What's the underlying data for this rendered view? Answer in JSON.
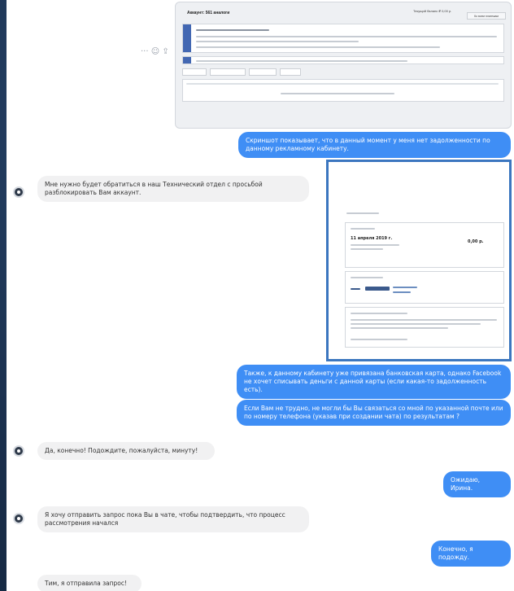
{
  "messages": {
    "m1": "Скриншот показывает, что в данный момент у меня нет задолженности по данному рекламному кабинету.",
    "m2": "Мне нужно будет обратиться в наш Технический отдел с просьбой разблокировать Вам аккаунт.",
    "m3": "Также, к данному кабинету уже привязана банковская карта, однако Facebook не хочет списывать деньги с данной карты (если какая-то задолженность есть).",
    "m4": "Если Вам не трудно, не могли бы Вы связаться со мной по указанной почте или по номеру телефона (указав при создании чата) по результатам ?",
    "m5": "Да, конечно! Подождите, пожалуйста, минуту!",
    "m6": "Ожидаю, Ирина.",
    "m7": "Я хочу отправить запрос пока Вы в чате, чтобы подтвердить, что процесс рассмотрения начался",
    "m8": "Конечно, я подожду.",
    "m9": "Тим, я отправила запрос!"
  },
  "shot1": {
    "header": "Аккаунт: 561 аналоги",
    "balance": "Текущий баланс ₽ 0,00 р.",
    "button": "Ко всем платежам"
  },
  "shot2": {
    "date": "11 апреля 2019 г.",
    "amount": "0,00 р."
  },
  "icons": [
    "more-icon",
    "reaction-icon",
    "share-icon"
  ]
}
